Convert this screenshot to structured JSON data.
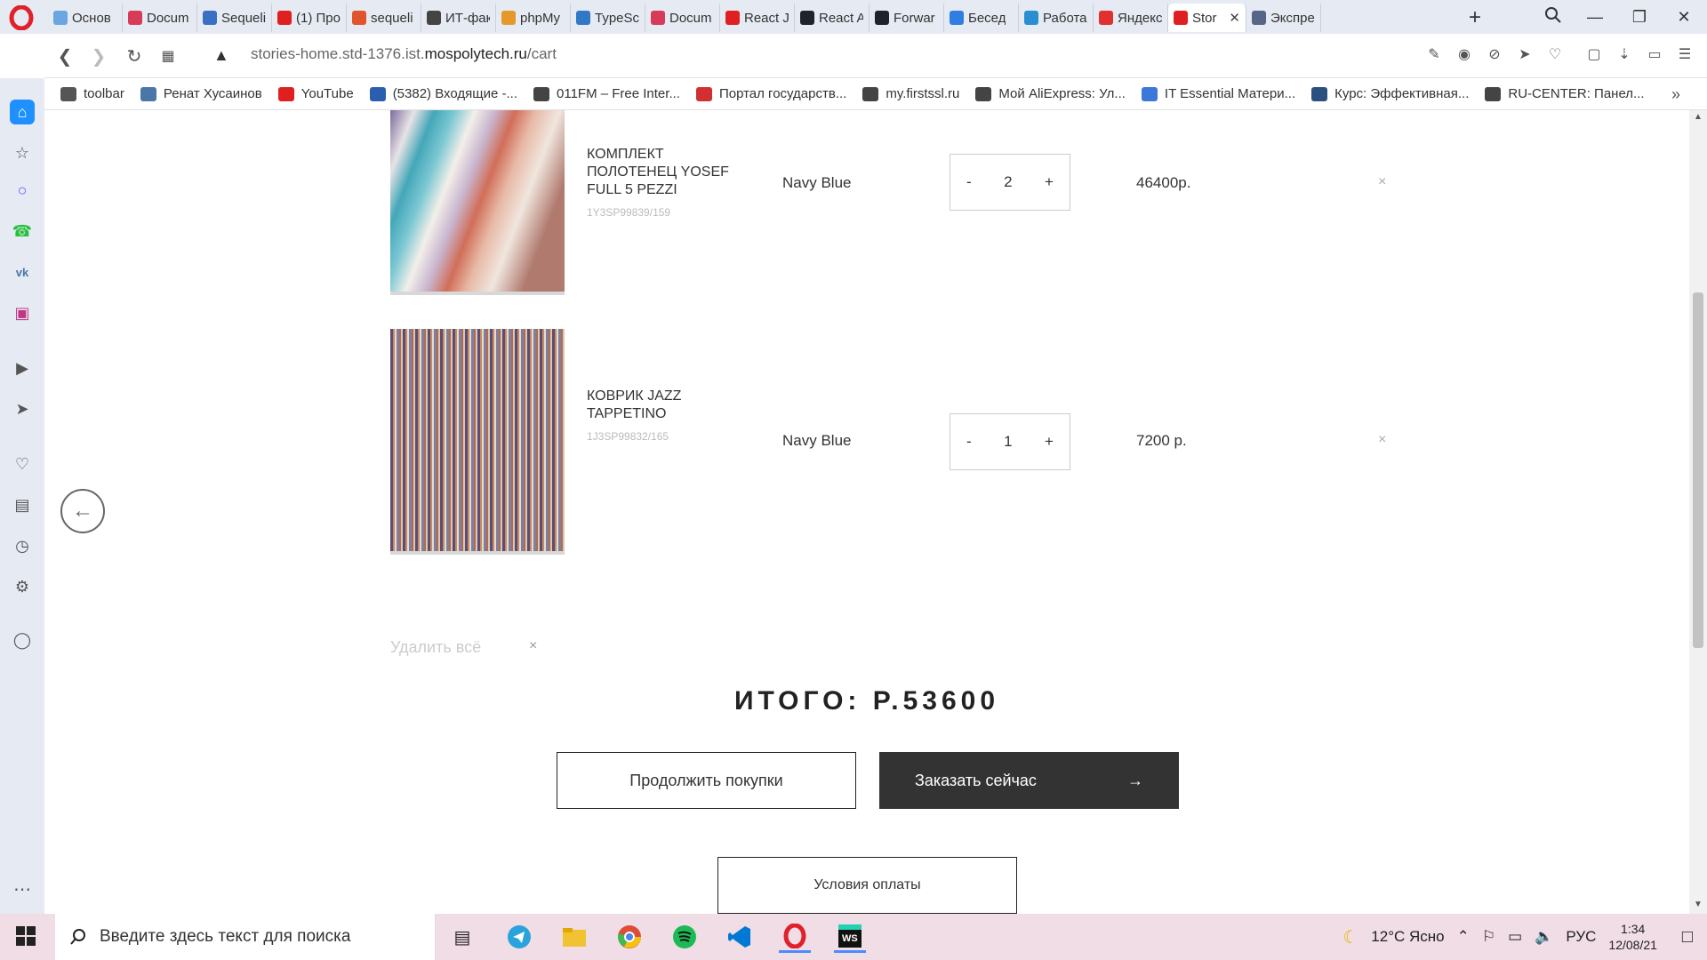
{
  "tabs": [
    {
      "label": "Основ",
      "color": "#6aa6e0"
    },
    {
      "label": "Docum",
      "color": "#d83b57"
    },
    {
      "label": "Sequeli",
      "color": "#3a6fc4"
    },
    {
      "label": "(1) Про",
      "color": "#e02020"
    },
    {
      "label": "sequeli",
      "color": "#e0552e"
    },
    {
      "label": "ИТ-фак",
      "color": "#444444"
    },
    {
      "label": "phpMy",
      "color": "#e39a2b"
    },
    {
      "label": "TypeSc",
      "color": "#3178c6"
    },
    {
      "label": "Docum",
      "color": "#d83b57"
    },
    {
      "label": "React J",
      "color": "#e02020"
    },
    {
      "label": "React A",
      "color": "#20232a"
    },
    {
      "label": "Forwar",
      "color": "#20232a"
    },
    {
      "label": "Бесед",
      "color": "#2f7ee0"
    },
    {
      "label": "Работа",
      "color": "#2a8fd0"
    },
    {
      "label": "Яндекс",
      "color": "#e03030"
    },
    {
      "label": "Stor",
      "color": "#e02020",
      "active": true
    },
    {
      "label": "Экспре",
      "color": "#556688"
    }
  ],
  "url": {
    "prefix": "stories-home.std-1376.ist.",
    "host": "mospolytech.ru",
    "path": "/cart"
  },
  "bookmarks": [
    {
      "label": "toolbar",
      "icon": "folder-icon",
      "color": "#555555"
    },
    {
      "label": "Ренат Хусаинов",
      "icon": "vk-icon",
      "color": "#4a76a8"
    },
    {
      "label": "YouTube",
      "icon": "youtube-icon",
      "color": "#e02020"
    },
    {
      "label": "(5382) Входящие -...",
      "icon": "mail-icon",
      "color": "#2a5fb0"
    },
    {
      "label": "011FM – Free Inter...",
      "icon": "file-icon",
      "color": "#444444"
    },
    {
      "label": "Портал государств...",
      "icon": "gov-icon",
      "color": "#d03030"
    },
    {
      "label": "my.firstssl.ru",
      "icon": "file-icon",
      "color": "#444444"
    },
    {
      "label": "Мой AliExpress: Ул...",
      "icon": "file-icon",
      "color": "#444444"
    },
    {
      "label": "IT Essential Матери...",
      "icon": "doc-icon",
      "color": "#3c78d8"
    },
    {
      "label": "Курс: Эффективная...",
      "icon": "course-icon",
      "color": "#2a5080"
    },
    {
      "label": "RU-CENTER: Панел...",
      "icon": "file-icon",
      "color": "#444444"
    }
  ],
  "cart": {
    "items": [
      {
        "name": "КОМПЛЕКТ ПОЛОТЕНЕЦ YOSEF FULL 5 PEZZI",
        "sku": "1Y3SP99839/159",
        "color": "Navy Blue",
        "qty_minus": "-",
        "qty": "2",
        "qty_plus": "+",
        "price": "46400р.",
        "remove": "×"
      },
      {
        "name": "КОВРИК JAZZ TAPPETINO",
        "sku": "1J3SP99832/165",
        "color": "Navy Blue",
        "qty_minus": "-",
        "qty": "1",
        "qty_plus": "+",
        "price": "7200 р.",
        "remove": "×"
      }
    ],
    "clear_all": "Удалить всё",
    "clear_all_icon": "×",
    "total": "ИТОГО: Р.53600",
    "continue_label": "Продолжить покупки",
    "order_label": "Заказать сейчас",
    "order_arrow": "→",
    "terms_label": "Условия оплаты"
  },
  "taskbar": {
    "search_placeholder": "Введите здесь текст для поиска",
    "weather": "12°C Ясно",
    "lang": "РУС",
    "time": "1:34",
    "date": "12/08/21"
  }
}
